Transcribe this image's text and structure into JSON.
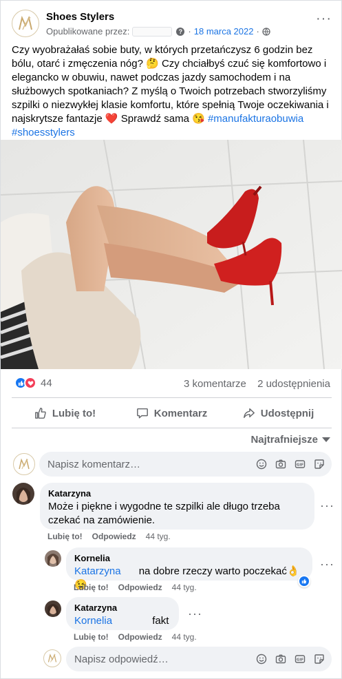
{
  "post": {
    "page_name": "Shoes Stylers",
    "published_by_label": "Opublikowane przez:",
    "date": "18 marca 2022",
    "text": "Czy wyobrażałaś sobie buty, w których przetańczysz 6 godzin bez bólu, otarć i zmęczenia nóg? 🤔 Czy chciałbyś czuć się komfortowo i elegancko w obuwiu, nawet podczas jazdy samochodem i na służbowych spotkaniach? Z myślą o Twoich potrzebach stworzyliśmy szpilki o niezwykłej klasie komfortu, które spełnią Twoje oczekiwania i najskrytsze fantazje ❤️ Sprawdź sama 😘 ",
    "hashtag1": "#manufakturaobuwia",
    "hashtag2": "#shoesstylers"
  },
  "engagement": {
    "reaction_count": "44",
    "comments": "3 komentarze",
    "shares": "2 udostępnienia"
  },
  "actions": {
    "like": "Lubię to!",
    "comment": "Komentarz",
    "share": "Udostępnij"
  },
  "sort_label": "Najtrafniejsze",
  "comment_input": {
    "placeholder": "Napisz komentarz…"
  },
  "comments": [
    {
      "author": "Katarzyna",
      "text": "Może i piękne i wygodne te szpilki ale długo trzeba czekać na zamówienie.",
      "like": "Lubię to!",
      "reply": "Odpowiedz",
      "time": "44 tyg."
    }
  ],
  "replies": [
    {
      "author": "Kornelia",
      "mention": "Katarzyna",
      "text": "na dobre rzeczy warto poczekać👌😉",
      "like": "Lubię to!",
      "reply": "Odpowiedz",
      "time": "44 tyg."
    },
    {
      "author": "Katarzyna",
      "mention": "Kornelia",
      "text": "fakt",
      "like": "Lubię to!",
      "reply": "Odpowiedz",
      "time": "44 tyg."
    }
  ],
  "reply_input": {
    "placeholder": "Napisz odpowiedź…"
  },
  "colors": {
    "accent": "#1b74e4",
    "like_blue": "#1877f2",
    "love_red": "#f33e58",
    "logo_gold": "#c9a96e"
  }
}
